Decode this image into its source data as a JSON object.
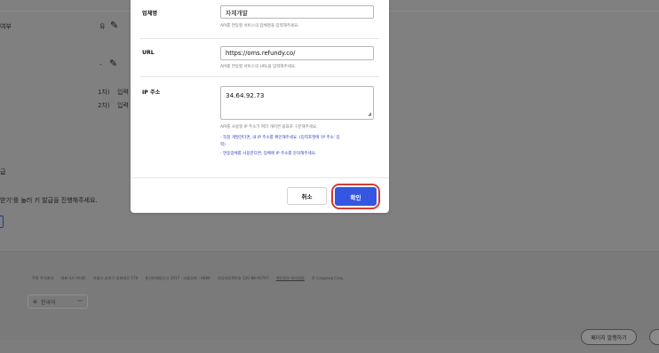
{
  "background": {
    "left_labels": {
      "top": "여부",
      "issue": "급",
      "instruction": "받기'를 눌러 키 발급을 진행해주세요."
    },
    "column_marks": {
      "u": "유",
      "dash": "-"
    },
    "order_rows": [
      {
        "num": "1차)",
        "text": "입력"
      },
      {
        "num": "2차)",
        "text": "입력"
      }
    ],
    "footer": {
      "links": [
        "쿠팡 주식회사",
        "대표이사 박대준",
        "서울시 송파구 송파대로 570",
        "통신판매업신고 2017 - 서울송파 - 0680",
        "사업자등록번호 120-88-00767",
        "개인정보 처리방침",
        "© Coupang Corp."
      ],
      "underlined_link_index": 5,
      "language": "한국어"
    },
    "floating_buttons": [
      "페이지 발행하기"
    ]
  },
  "modal": {
    "rows": [
      {
        "label": "업체명",
        "value": "자체개발",
        "help": "API를 연동할 서비스의 업체명을 입력해주세요."
      },
      {
        "label": "URL",
        "value": "https://oms.refundy.co/",
        "help": "API를 연동할 서비스의 URL을 입력해주세요."
      },
      {
        "label": "IP 주소",
        "value": "34.64.92.73",
        "help": "API를 사용할 IP 주소가 여러 개이면 쉼표로 구분해주세요.",
        "note1_line1": "- 직접 개발한다면, 내 IP 주소를 확인해주세요. (입력포맷에 'IP 주소' 입",
        "note1_line2": "력)",
        "note2": "- 연동업체를 사용한다면, 업체에 IP 주소를 문의해주세요."
      }
    ],
    "cancel_label": "취소",
    "confirm_label": "확인"
  },
  "colors": {
    "primary": "#3456e0",
    "highlight_ring": "#d33b36",
    "overlay": "#808080"
  }
}
